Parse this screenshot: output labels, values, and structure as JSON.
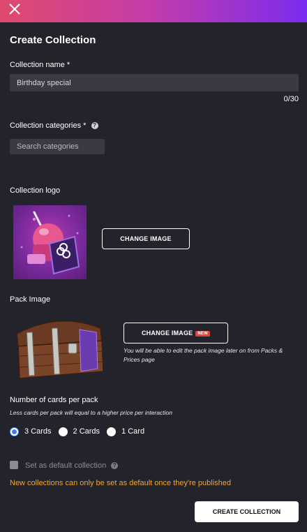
{
  "header": {
    "close_icon": "close-icon",
    "gradient_colors": [
      "#e14a6d",
      "#c23cab",
      "#7a2cf0"
    ]
  },
  "form": {
    "title": "Create Collection",
    "collection_name": {
      "label": "Collection name *",
      "value": "Birthday special",
      "counter": "0/30"
    },
    "categories": {
      "label": "Collection categories *",
      "placeholder": "Search categories",
      "help_icon": "question-circle-icon"
    },
    "logo": {
      "label": "Collection logo",
      "button_label": "CHANGE IMAGE"
    },
    "pack_image": {
      "label": "Pack Image",
      "button_label": "CHANGE IMAGE",
      "badge": "NEW",
      "hint": "You will be able to edit the pack image later on from Packs & Prices page"
    },
    "cards_per_pack": {
      "label": "Number of cards per pack",
      "hint": "Less cards per pack will equal to a higher price per interaction",
      "options": [
        "3 Cards",
        "2 Cards",
        "1 Card"
      ],
      "selected": "3 Cards"
    },
    "default_collection": {
      "label": "Set as default collection",
      "checked": false,
      "warning": "New collections can only be set as default once they're published"
    },
    "submit_label": "CREATE COLLECTION"
  },
  "colors": {
    "background": "#23242b",
    "input_bg": "#3a3b42",
    "warning": "#f5a623",
    "radio_selected": "#3c7ff0",
    "badge": "#e0463f"
  }
}
